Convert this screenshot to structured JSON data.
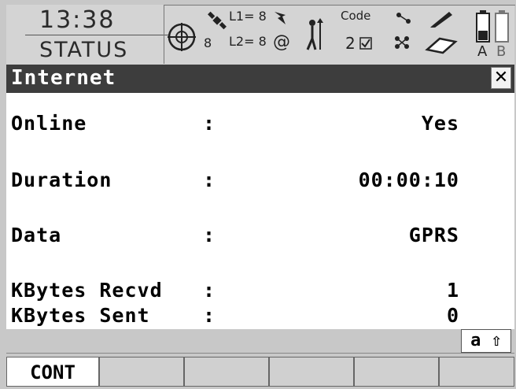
{
  "status_bar": {
    "time": "13:38",
    "mode": "STATUS",
    "icons": {
      "crosshair": "crosshair-icon",
      "satellite_count": "8",
      "l1": "L1= 8",
      "l2": "L2= 8",
      "code": "Code",
      "code_count": "2",
      "battery_a": "A",
      "battery_b": "B"
    }
  },
  "window": {
    "title": "Internet",
    "close_glyph": "✕"
  },
  "fields": [
    {
      "label": "Online",
      "colon": ":",
      "value": "Yes"
    },
    {
      "label": "Duration",
      "colon": ":",
      "value": "00:00:10"
    },
    {
      "label": "Data",
      "colon": ":",
      "value": "GPRS"
    },
    {
      "label": "KBytes Recvd",
      "colon": ":",
      "value": "1"
    },
    {
      "label": "KBytes Sent",
      "colon": ":",
      "value": "0"
    }
  ],
  "input_mode": "a ⇧",
  "function_keys": [
    "CONT",
    "",
    "",
    "",
    "",
    ""
  ]
}
